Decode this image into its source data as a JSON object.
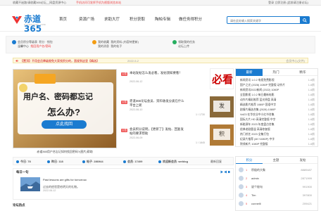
{
  "topbar": {
    "left": "收藏不迷路!请收藏365论坛__网盘资源中心",
    "mid": "手机访问可发挥手机为视版浏览本站",
    "right": "登录 立即注册 (此前请注册论坛)"
  },
  "logo": {
    "text": "赤道365",
    "sub": "CHIDAO365.COM"
  },
  "nav": [
    "首页",
    "资源广场",
    "求助大厅",
    "积分获取",
    "陶帕专辑",
    "做任务得积分"
  ],
  "search": {
    "placeholder": "请在此处输入搜索关键字",
    "login": "登录 立即注册 (找回密码/注册)"
  },
  "quick": [
    {
      "l1": "会员积分等级表",
      "l2": "积分 · 钱包",
      "r1": "温馨中心",
      "r2": "找回用户名/密码"
    },
    {
      "l1": "我的收藏",
      "l2": "我的资料 (内容待更新)",
      "r1": "我的消息",
      "r2": "我的帖子"
    },
    {
      "l1": "领取我的任务",
      "l2": "论坛上传",
      "r1": "",
      "r2": ""
    }
  ],
  "announce": {
    "text": "【置顶】不用会员降级限免大家找积分的，直接到这里【精选】",
    "time": "2022-5-2",
    "right": "会员中心(文件)"
  },
  "banner": {
    "line1": "用户名、密码都忘记",
    "line2": "怎么办?",
    "button": "点此找回",
    "badge": "必看",
    "caption": "赤道365用户名忘记如何找回密码?(图片)帮助"
  },
  "items": [
    {
      "tag": "公告",
      "title": "本站发帖怎么发必看，发帖须知要看！",
      "date": "2022-06-12",
      "cat": "",
      "view": "必看",
      "thumb": "必看"
    },
    {
      "tag": "公告",
      "title": "赤道365论坛会员、资料收发分类在什么平台上呢",
      "date": "2022-06-10",
      "cat": "",
      "view": "1 / 1730",
      "thumb": "发"
    },
    {
      "tag": "公告",
      "title": "会员积分说明，【更新了】发帖、回复发帖的要求帮助",
      "date": "2022-06-09",
      "cat": "",
      "view": "1 / 1845",
      "thumb": "积"
    }
  ],
  "side": {
    "tabs": [
      "最新",
      "热门",
      "精华"
    ],
    "items": [
      {
        "t": "新闻资讯 1.0.2 电视免费影视",
        "d": "1-6前"
      },
      {
        "t": "国产之光 (2028) 1080P 完整版 动作片",
        "d": "1-6前"
      },
      {
        "t": "新闻资讯2022新闻 (2022) 1080P",
        "d": "1-6前"
      },
      {
        "t": "全国影视 1.0.2 每日最新电影",
        "d": "1-6前"
      },
      {
        "t": "动作片精彩推荐 蓝光原盘 高清",
        "d": "1-6前"
      },
      {
        "t": "精选影片推荐 1080P 国语中字",
        "d": "1-6前"
      },
      {
        "t": "剧情片精选合集 (2028) 1080P",
        "d": "1-6前"
      },
      {
        "t": "Vol23 在华农业中小红书合集",
        "d": "1-6前"
      },
      {
        "t": "国际大片 HD 高清完整版 中字",
        "d": "1-6前"
      },
      {
        "t": "新能源车 2023 年度盘点合集",
        "d": "1-6前"
      },
      {
        "t": "经典老剧重温 高清修复版",
        "d": "1-6前"
      },
      {
        "t": "热门综艺 2023 全集打包",
        "d": "1-6前"
      },
      {
        "t": "纪录片推荐 (4K+1080P) 中字",
        "d": "1-6前"
      },
      {
        "t": "院线新片 1080P 完整版",
        "d": "1-6前"
      }
    ]
  },
  "stats": [
    {
      "k": "今日",
      "v": "78"
    },
    {
      "k": "昨日",
      "v": "118"
    },
    {
      "k": "帖子",
      "v": "286944"
    },
    {
      "k": "会员",
      "v": "17409"
    },
    {
      "k": "欢迎新会员",
      "v": "weblog"
    }
  ],
  "stats_right": "最新回复",
  "daily": {
    "title": "每日一句",
    "en": "Past lessons are gifts for tomorrow.",
    "zh": "过去的经验是给明天的礼物。",
    "src": "2022-06-12"
  },
  "hot_title": "论坛热点",
  "rank": {
    "tabs": [
      "积分",
      "主题",
      "发帖"
    ],
    "rows": [
      {
        "n": "1",
        "name": "积极的大象",
        "score": "8889487"
      },
      {
        "n": "2",
        "name": "admin",
        "score": "2871999"
      },
      {
        "n": "3",
        "name": "说个秘句",
        "score": "991900"
      },
      {
        "n": "4",
        "name": "Tim",
        "score": "397800"
      },
      {
        "n": "5",
        "name": "connelli",
        "score": "209421"
      }
    ]
  }
}
